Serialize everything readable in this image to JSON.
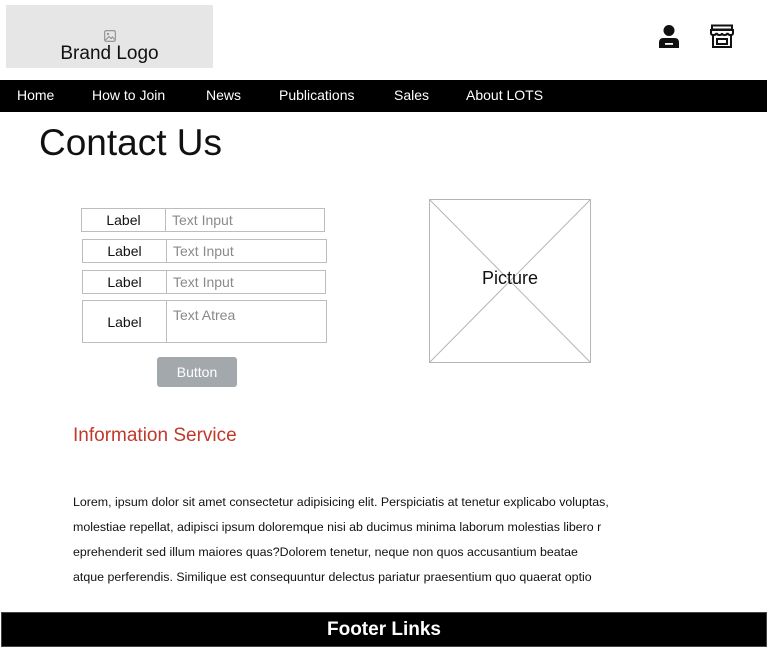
{
  "header": {
    "logo_text": "Brand Logo",
    "icons": [
      "image-icon",
      "user-icon",
      "store-icon"
    ]
  },
  "nav": {
    "items": [
      {
        "label": "Home"
      },
      {
        "label": "How to Join"
      },
      {
        "label": "News"
      },
      {
        "label": "Publications"
      },
      {
        "label": "Sales"
      },
      {
        "label": "About LOTS"
      }
    ]
  },
  "main": {
    "title": "Contact Us",
    "form": {
      "rows": [
        {
          "label": "Label",
          "placeholder": "Text Input",
          "value": ""
        },
        {
          "label": "Label",
          "placeholder": "Text Input",
          "value": ""
        },
        {
          "label": "Label",
          "placeholder": "Text Input",
          "value": ""
        },
        {
          "label": "Label",
          "placeholder": "Text Atrea",
          "value": ""
        }
      ],
      "button_label": "Button"
    },
    "picture_label": "Picture",
    "section_heading": "Information Service",
    "body_lines": [
      "Lorem, ipsum dolor sit amet consectetur adipisicing elit. Perspiciatis at tenetur explicabo voluptas,",
      "molestiae repellat, adipisci ipsum doloremque nisi ab ducimus minima laborum molestias libero r",
      "eprehenderit sed illum maiores quas?Dolorem tenetur, neque non quos accusantium beatae",
      "atque perferendis. Similique est consequuntur delectus pariatur praesentium quo quaerat optio"
    ]
  },
  "footer": {
    "label": "Footer Links"
  },
  "colors": {
    "nav_bg": "#000000",
    "accent_heading": "#c0392b",
    "button_bg": "#a3a8ad",
    "logo_bg": "#e6e6e6"
  }
}
